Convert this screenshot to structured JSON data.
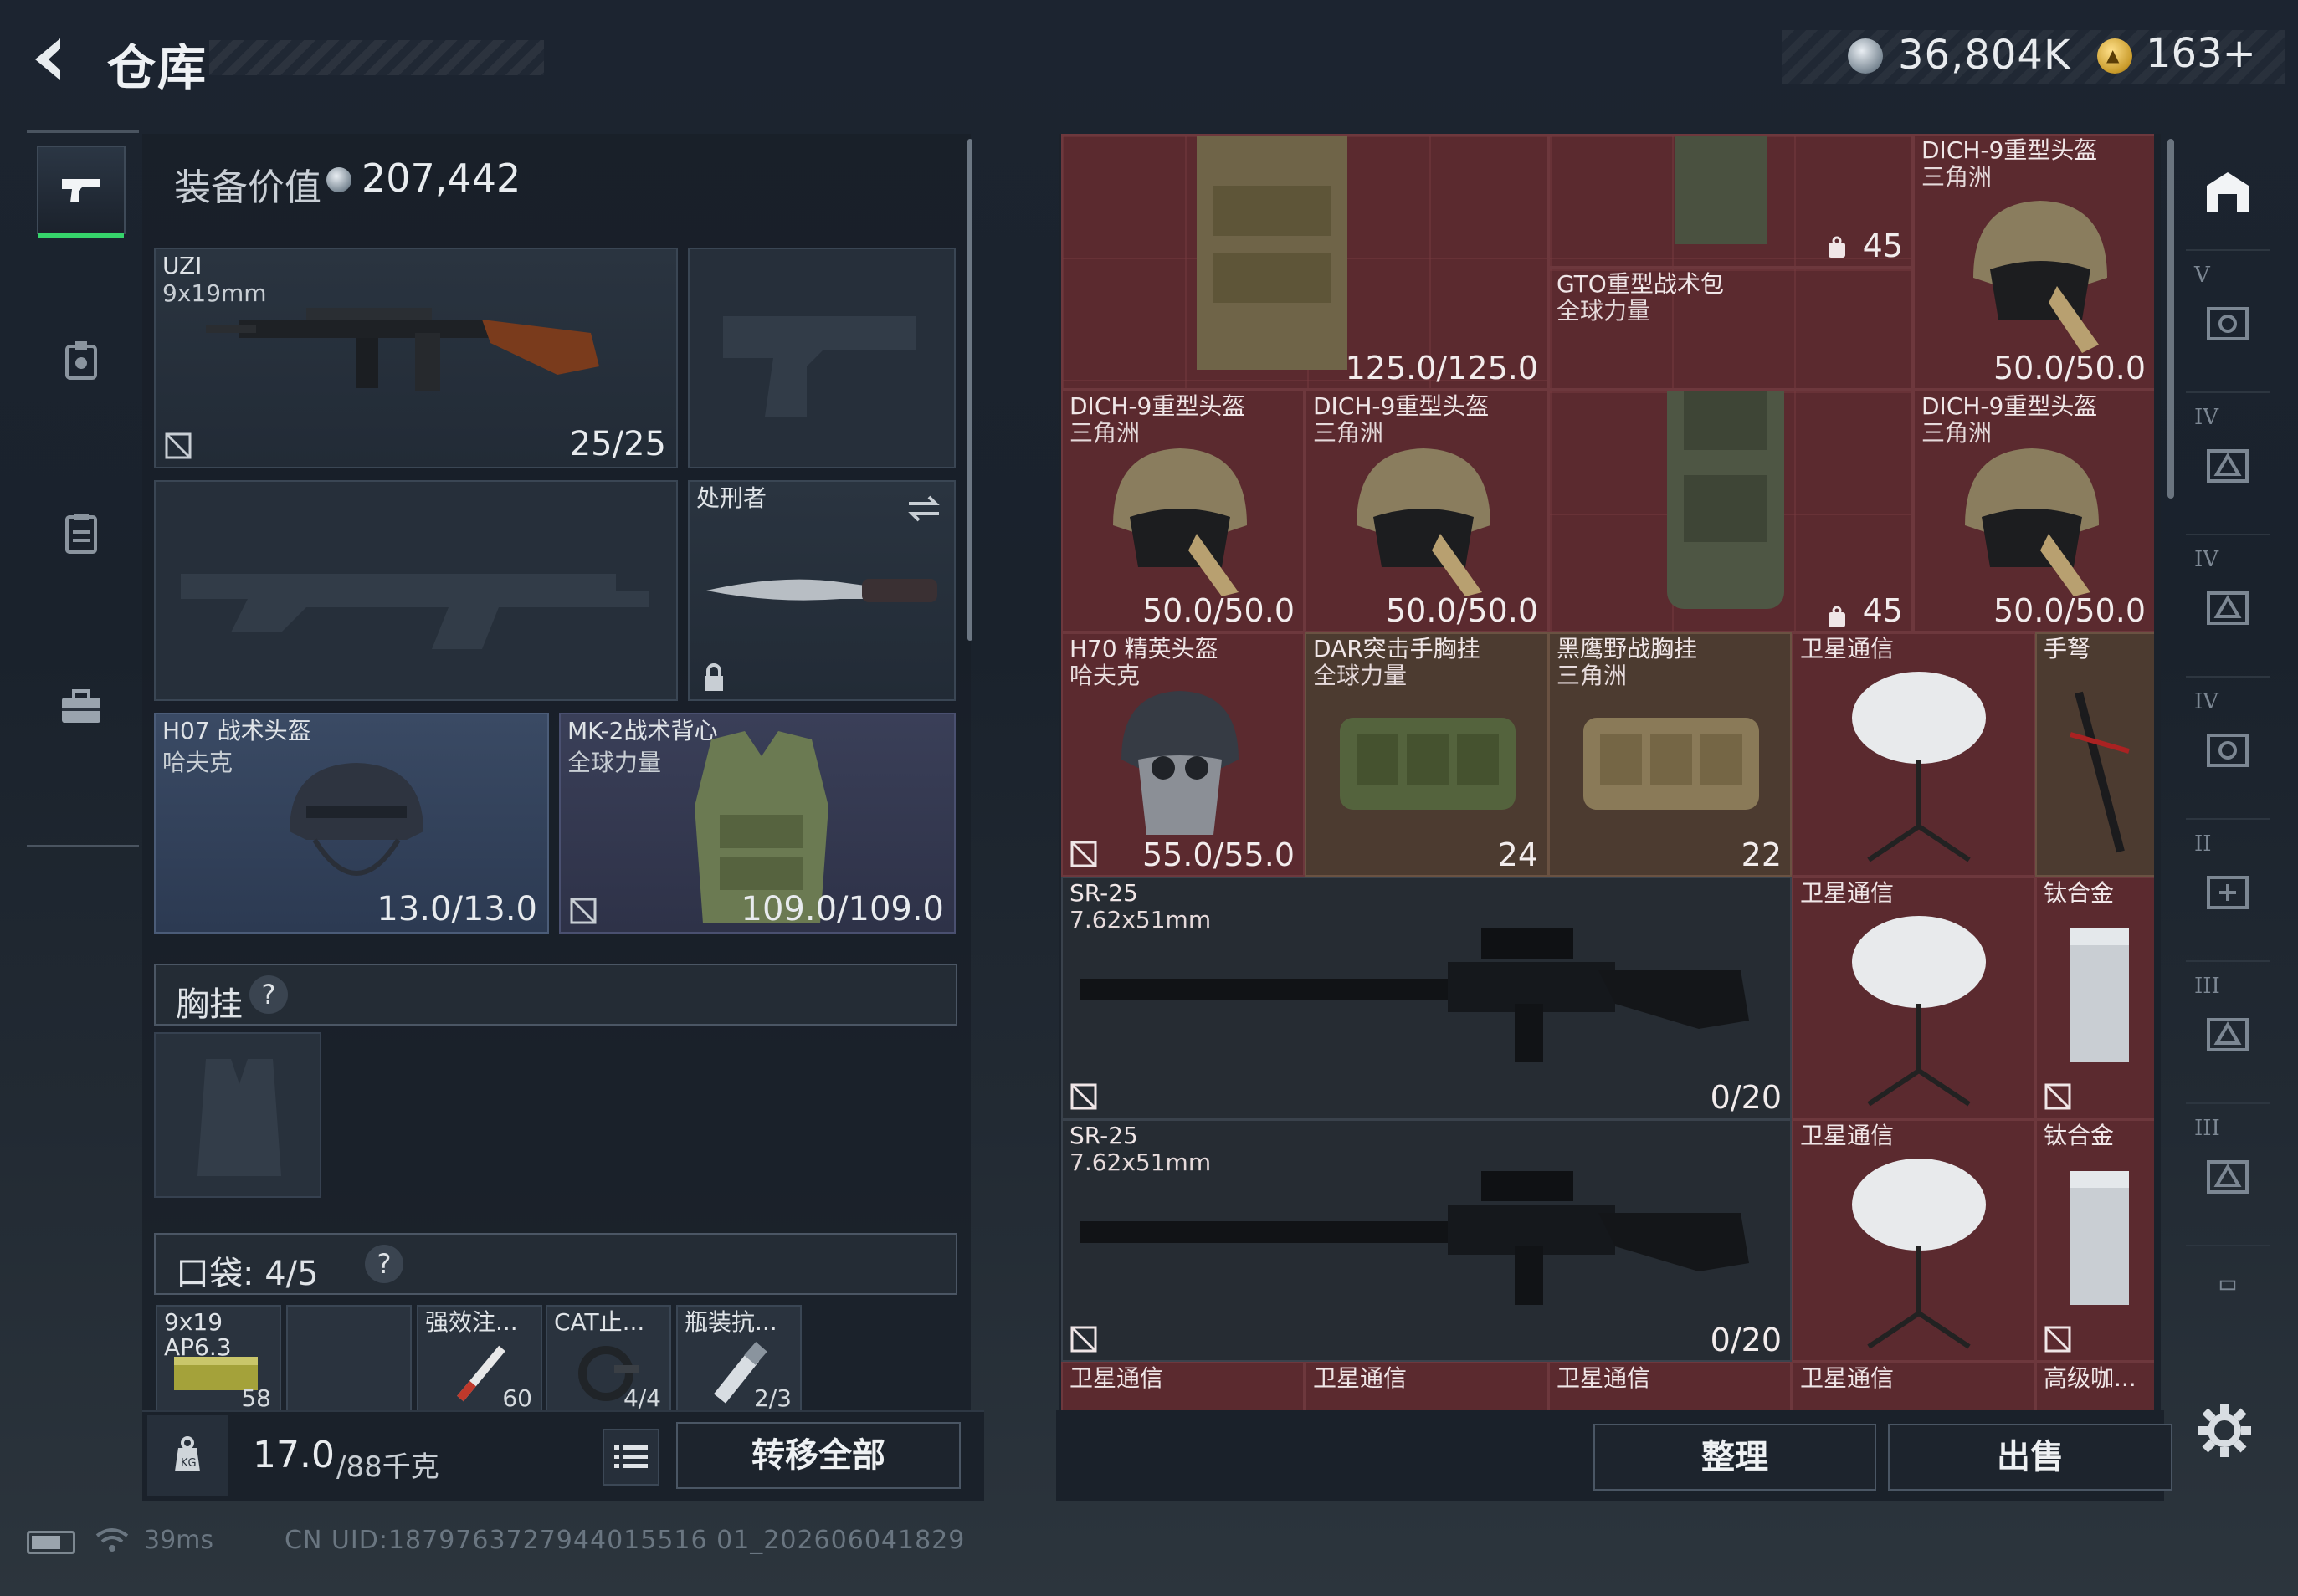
{
  "header": {
    "title": "仓库",
    "money": "36,804K",
    "premium": "163",
    "premium_plus": "+"
  },
  "left_nav": {
    "items": [
      {
        "name": "weapons",
        "icon": "pistol-icon",
        "active": true
      },
      {
        "name": "armor-tag",
        "icon": "armor-tag-icon"
      },
      {
        "name": "clipboard",
        "icon": "clipboard-icon"
      },
      {
        "name": "case",
        "icon": "briefcase-icon"
      }
    ]
  },
  "loadout": {
    "equip_value_label": "装备价值",
    "equip_value": "207,442",
    "uzi": {
      "name": "UZI",
      "caliber": "9x19mm",
      "ammo": "25/25"
    },
    "knife": {
      "name": "处刑者"
    },
    "helmet": {
      "name": "H07 战术头盔",
      "brand": "哈夫克",
      "durability": "13.0/13.0"
    },
    "armor": {
      "name": "MK-2战术背心",
      "brand": "全球力量",
      "durability": "109.0/109.0"
    },
    "chest_rig_label": "胸挂",
    "pocket_label": "口袋: 4/5",
    "pockets": [
      {
        "name": "9x19",
        "sub": "AP6.3",
        "count": "58"
      },
      {
        "name": "",
        "sub": "",
        "count": ""
      },
      {
        "name": "强效注...",
        "sub": "",
        "count": "60"
      },
      {
        "name": "CAT止...",
        "sub": "",
        "count": "4/4"
      },
      {
        "name": "瓶装抗...",
        "sub": "",
        "count": "2/3"
      }
    ]
  },
  "bottom_left": {
    "weight": "17.0",
    "weight_max": "/88千克",
    "transfer_all": "转移全部"
  },
  "storage": {
    "top_left_value": "125.0/125.0",
    "top_mid_count": "45",
    "top_right": {
      "name": "DICH-9重型头盔",
      "brand": "三角洲",
      "durability": "50.0/50.0"
    },
    "backpack": {
      "name": "GTO重型战术包",
      "brand": "全球力量",
      "count": "45"
    },
    "helmets_row": [
      {
        "name": "DICH-9重型头盔",
        "brand": "三角洲",
        "durability": "50.0/50.0"
      },
      {
        "name": "DICH-9重型头盔",
        "brand": "三角洲",
        "durability": "50.0/50.0"
      },
      {
        "name": "DICH-9重型头盔",
        "brand": "三角洲",
        "durability": "50.0/50.0"
      }
    ],
    "row3": [
      {
        "name": "H70 精英头盔",
        "brand": "哈夫克",
        "value": "55.0/55.0"
      },
      {
        "name": "DAR突击手胸挂",
        "brand": "全球力量",
        "value": "24"
      },
      {
        "name": "黑鹰野战胸挂",
        "brand": "三角洲",
        "value": "22"
      },
      {
        "name": "卫星通信",
        "brand": "",
        "value": ""
      },
      {
        "name": "手弩",
        "brand": "",
        "value": ""
      }
    ],
    "sr25_a": {
      "name": "SR-25",
      "caliber": "7.62x51mm",
      "ammo": "0/20"
    },
    "sr25_b": {
      "name": "SR-25",
      "caliber": "7.62x51mm",
      "ammo": "0/20"
    },
    "sat_comm": "卫星通信",
    "titanium": "钛合金",
    "bottom_row": [
      "卫星通信",
      "卫星通信",
      "卫星通信",
      "卫星通信",
      "高级咖..."
    ],
    "sort": "整理",
    "sell": "出售"
  },
  "rail": {
    "tiers": [
      "V",
      "IV",
      "IV",
      "IV",
      "II",
      "III",
      "III"
    ]
  },
  "status": {
    "ping": "39ms",
    "uid": "CN UID:1879763727944015516 01_202606041829"
  },
  "colors": {
    "accent_green": "#36d46b",
    "storage_red": "#5b2a2f",
    "helmet_blue": "#3a4a64"
  }
}
